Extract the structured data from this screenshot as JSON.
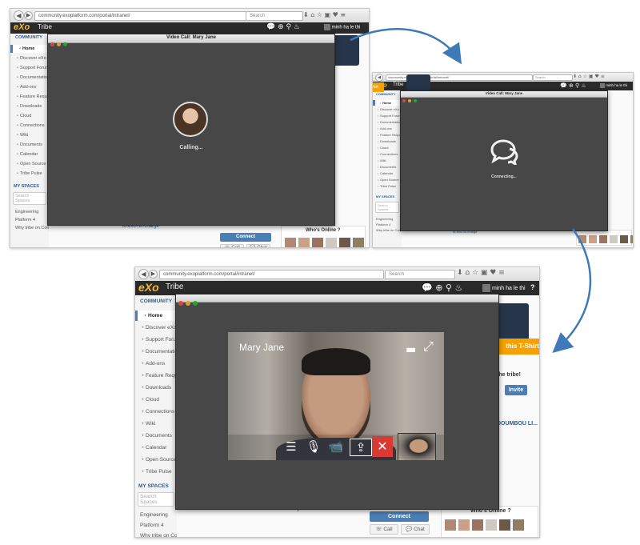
{
  "browser": {
    "url": "community.exoplatform.com/portal/intranet/",
    "search_placeholder": "Search"
  },
  "app": {
    "logo": "eXo",
    "brand": "Tribe",
    "user": "minh ha le thi",
    "help": "?"
  },
  "sidebar": {
    "community_heading": "COMMUNITY",
    "items": [
      {
        "label": "Home",
        "icon": "home-icon"
      },
      {
        "label": "Discover eXo",
        "icon": "discover-icon"
      },
      {
        "label": "Support Forum",
        "icon": "support-icon"
      },
      {
        "label": "Documentation",
        "icon": "book-icon"
      },
      {
        "label": "Add-ons",
        "icon": "addon-icon"
      },
      {
        "label": "Feature Requests",
        "icon": "bulb-icon"
      },
      {
        "label": "Downloads",
        "icon": "download-icon"
      },
      {
        "label": "Cloud",
        "icon": "cloud-icon"
      },
      {
        "label": "Connections",
        "icon": "user-icon"
      },
      {
        "label": "Wiki",
        "icon": "wiki-icon"
      },
      {
        "label": "Documents",
        "icon": "document-icon"
      },
      {
        "label": "Calendar",
        "icon": "calendar-icon"
      },
      {
        "label": "Open Source",
        "icon": "opensource-icon"
      },
      {
        "label": "Tribe Pulse",
        "icon": "pulse-icon"
      }
    ],
    "spaces_heading": "MY SPACES",
    "spaces_search_placeholder": "Search Spaces",
    "spaces": [
      "Engineering",
      "Platform 4",
      "Why tribe on Community"
    ]
  },
  "content": {
    "tshirt_cta": "this T-Shirt",
    "tribe_text": "the tribe!",
    "invite": "Invite",
    "profile_link": "DOUMBOU LI...",
    "activity_link": "to-exo-no-charge",
    "connect": "Connect",
    "call": "Call",
    "chat": "Chat",
    "whos_online": "Who's Online ?"
  },
  "call1": {
    "title": "Video Call: Mary Jane",
    "status": "Calling..."
  },
  "call2": {
    "title": "Video Call: Mary Jane",
    "status": "Connecting..."
  },
  "call3": {
    "caller_name": "Mary Jane"
  },
  "colors": {
    "appbar": "#2a2a2a",
    "accent_orange": "#f6a100",
    "link_blue": "#2f5e8e",
    "call_window": "#474747",
    "hangup_red": "#d93a33",
    "arrow_blue": "#3f7ab8"
  }
}
